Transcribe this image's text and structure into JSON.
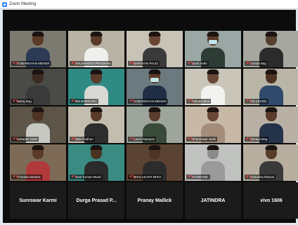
{
  "window": {
    "title": "Zoom Meeting",
    "app_icon": "zoom-icon"
  },
  "participants": [
    {
      "name": "GOBARDHAN MEHER",
      "bg": "#7c7a70",
      "skin": "#5b3a26",
      "shirt": "#2c3a55",
      "mask": false,
      "video": true
    },
    {
      "name": "SHUSHANTA PRADHAN",
      "bg": "#b9b3a5",
      "skin": "#5a3c2b",
      "shirt": "#f0f0ee",
      "mask": false,
      "video": true
    },
    {
      "name": "NARAYAN PALEI",
      "bg": "#c8c3b6",
      "skin": "#6a4533",
      "shirt": "#3a3a3a",
      "mask": false,
      "video": true
    },
    {
      "name": "Sunil Sethi",
      "bg": "#9aa7a4",
      "skin": "#5b3a28",
      "shirt": "#2d3c35",
      "mask": true,
      "video": true
    },
    {
      "name": "Ganda Bag",
      "bg": "#a6a79e",
      "skin": "#55402e",
      "shirt": "#2b2b2b",
      "mask": false,
      "video": true
    },
    {
      "name": "Balraj Bag",
      "bg": "#4a4b46",
      "skin": "#3b2a20",
      "shirt": "#3a3a3a",
      "mask": false,
      "video": true
    },
    {
      "name": "RM BARGARH",
      "bg": "#2f8a84",
      "skin": "#5a3c2b",
      "shirt": "#d8d8d4",
      "mask": false,
      "video": true
    },
    {
      "name": "GOBARDHAN MEHER",
      "bg": "#6c7a80",
      "skin": "#5b3a28",
      "shirt": "#1f2d45",
      "mask": true,
      "video": true
    },
    {
      "name": "Tukuna Bhoi",
      "bg": "#c9c5b9",
      "skin": "#6a4837",
      "shirt": "#f2f2f0",
      "mask": false,
      "video": true
    },
    {
      "name": "ZM KBCBG",
      "bg": "#b9b6a8",
      "skin": "#4d3322",
      "shirt": "#2f4a6a",
      "mask": false,
      "video": true,
      "active": true
    },
    {
      "name": "Sukadev Sethi",
      "bg": "#5c5548",
      "skin": "#4e3323",
      "shirt": "#c8c8c3",
      "mask": false,
      "video": true
    },
    {
      "name": "Balo Padhan",
      "bg": "#c2bdaf",
      "skin": "#5a3b29",
      "shirt": "#2d2d2d",
      "mask": false,
      "video": true
    },
    {
      "name": "Laxmi Narayan",
      "bg": "#9ea59a",
      "skin": "#5a3d2c",
      "shirt": "#3a4a3a",
      "mask": false,
      "video": true
    },
    {
      "name": "Dhaneswar Sethi",
      "bg": "#c8b9a6",
      "skin": "#6a4635",
      "shirt": "#a38d7a",
      "mask": false,
      "video": true
    },
    {
      "name": "Akhaya Bag",
      "bg": "#b8b0a4",
      "skin": "#5a3c2b",
      "shirt": "#24324a",
      "mask": false,
      "video": true
    },
    {
      "name": "Chhabila Behera",
      "bg": "#7d6b58",
      "skin": "#5b3a28",
      "shirt": "#b03a3a",
      "mask": false,
      "video": true
    },
    {
      "name": "Arun Kumar Mund",
      "bg": "#3a8c83",
      "skin": "#4a3222",
      "shirt": "#2b2b2b",
      "mask": false,
      "video": true
    },
    {
      "name": "BHALAKANT BHOI",
      "bg": "#5b4334",
      "skin": "#4d3322",
      "shirt": "#2c2c2c",
      "mask": false,
      "video": true
    },
    {
      "name": "GCDM KBL",
      "bg": "#c0c2c0",
      "skin": "#8a8a8a",
      "shirt": "#9a9a9a",
      "mask": false,
      "video": true
    },
    {
      "name": "Debarika Dharua",
      "bg": "#b7ae9f",
      "skin": "#5a3c2b",
      "shirt": "#3a3a3a",
      "mask": false,
      "video": true
    },
    {
      "name": "Sureswar Karmi",
      "video": false
    },
    {
      "name": "Durga Prasad P...",
      "video": false
    },
    {
      "name": "Pranay Mallick",
      "video": false
    },
    {
      "name": "JATINDRA",
      "video": false
    },
    {
      "name": "vivo 1606",
      "video": false
    }
  ]
}
